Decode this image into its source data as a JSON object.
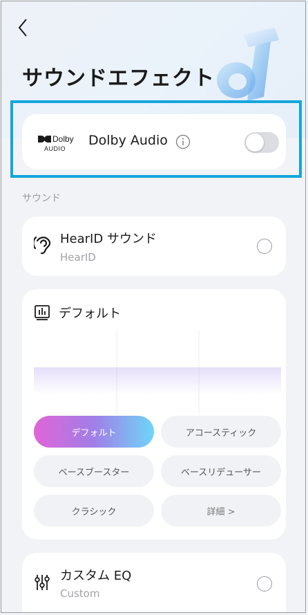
{
  "header": {
    "title": "サウンドエフェクト",
    "back_icon": "chevron-left-icon",
    "hero_icon": "dolby-3d-logo-icon"
  },
  "dolby": {
    "logo_top": "Dolby",
    "logo_bottom": "AUDIO",
    "label": "Dolby Audio",
    "info_icon": "info-icon",
    "enabled": false
  },
  "section": {
    "sound_label": "サウンド"
  },
  "hearid": {
    "icon": "ear-icon",
    "title": "HearID サウンド",
    "subtitle": "HearID",
    "selected": false
  },
  "eq": {
    "icon": "equalizer-chart-icon",
    "title": "デフォルト",
    "presets": [
      {
        "label": "デフォルト",
        "active": true
      },
      {
        "label": "アコースティック",
        "active": false
      },
      {
        "label": "ベースブースター",
        "active": false
      },
      {
        "label": "ベースリデューサー",
        "active": false
      },
      {
        "label": "クラシック",
        "active": false
      },
      {
        "label": "詳細 >",
        "active": false
      }
    ]
  },
  "custom": {
    "icon": "sliders-icon",
    "title": "カスタム EQ",
    "subtitle": "Custom",
    "selected": false
  },
  "colors": {
    "accent_border": "#13a6dc",
    "gradient_start": "#e064d8",
    "gradient_end": "#6fd5f8",
    "background": "#f2f3f6"
  }
}
